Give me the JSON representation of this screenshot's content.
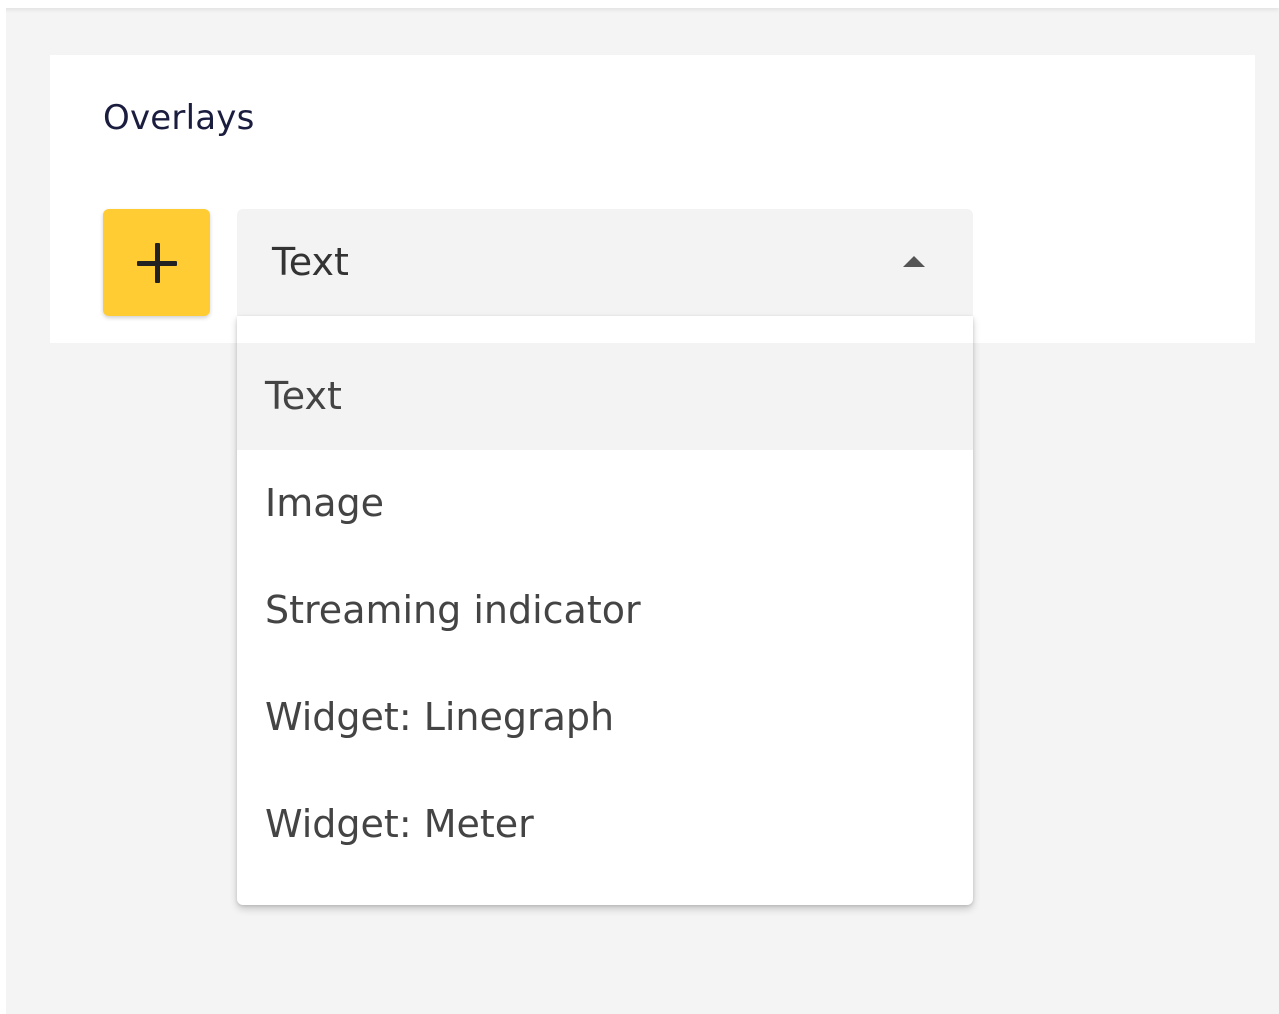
{
  "overlays": {
    "title": "Overlays",
    "add_button_icon": "plus-icon",
    "select": {
      "value": "Text",
      "caret_icon": "caret-up-icon"
    },
    "options": [
      {
        "label": "Text",
        "selected": true
      },
      {
        "label": "Image",
        "selected": false
      },
      {
        "label": "Streaming indicator",
        "selected": false
      },
      {
        "label": "Widget: Linegraph",
        "selected": false
      },
      {
        "label": "Widget: Meter",
        "selected": false
      }
    ]
  },
  "colors": {
    "accent": "#ffcc33",
    "background": "#f4f4f4",
    "card": "#ffffff",
    "title_text": "#1b1d3f"
  }
}
